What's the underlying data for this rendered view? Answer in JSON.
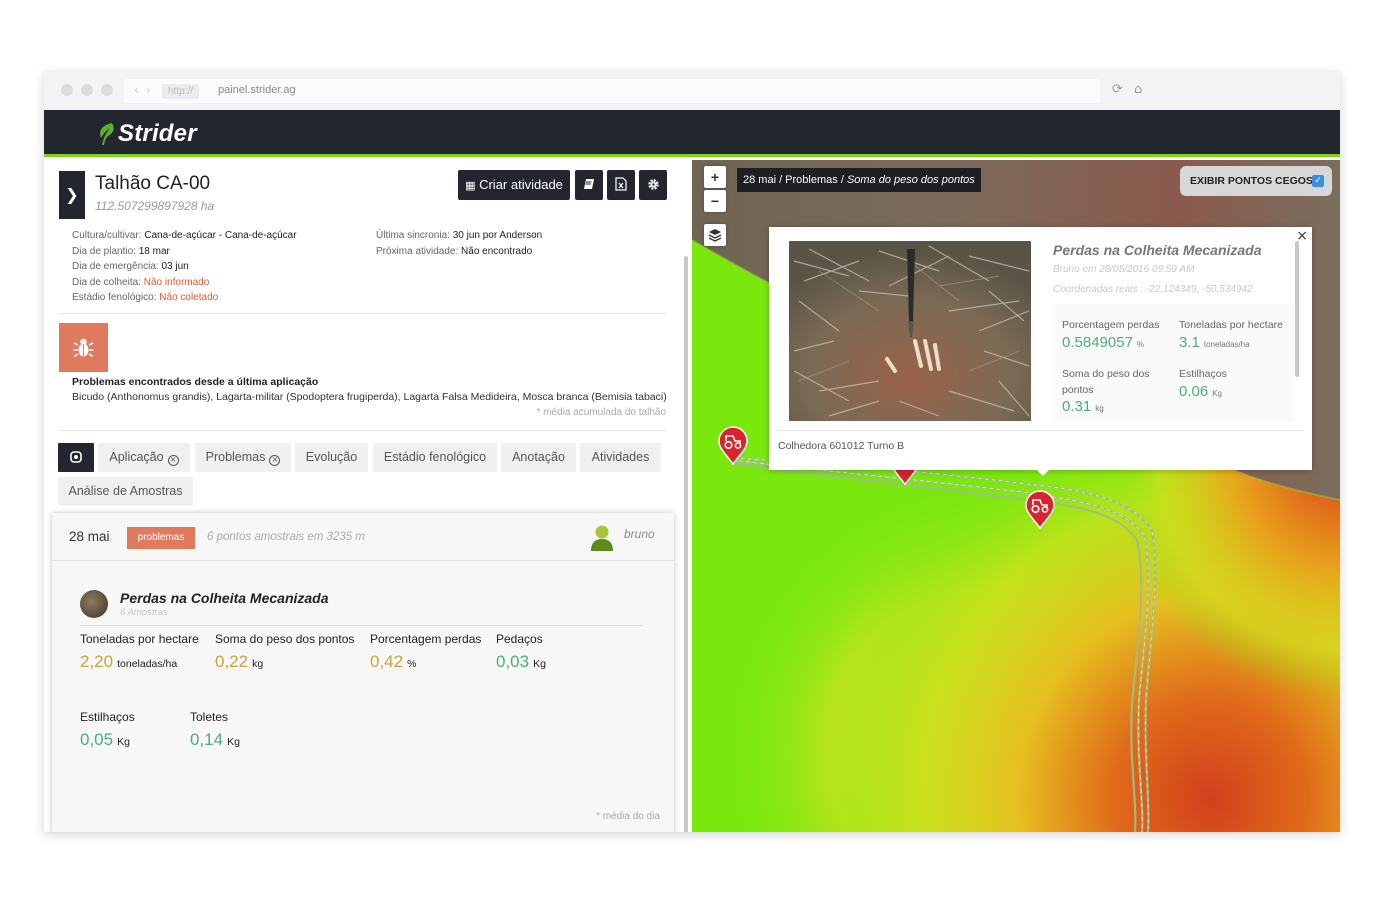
{
  "browser": {
    "url_proto": "http://",
    "url": "painel.strider.ag",
    "nav_back": "‹",
    "nav_forward": "›",
    "reload_glyph": "⟳",
    "home_glyph": "⌂"
  },
  "app": {
    "brand": "Strider",
    "accent": "#7ed321",
    "dark": "#23252f"
  },
  "field": {
    "title": "Talhão CA-00",
    "area": "112.507299897928 ha",
    "create_activity": "Criar atividade",
    "info_left": [
      {
        "label": "Cultura/cultivar: ",
        "value": "Cana-de-açúcar - Cana-de-açúcar",
        "status": "normal"
      },
      {
        "label": "Dia de plantio: ",
        "value": "18 mar",
        "status": "normal"
      },
      {
        "label": "Dia de emergência: ",
        "value": "03 jun",
        "status": "normal"
      },
      {
        "label": "Dia de colheita: ",
        "value": "Não informado",
        "status": "alert"
      },
      {
        "label": "Estádio fenológico: ",
        "value": "Não coletado",
        "status": "alert"
      }
    ],
    "info_right": [
      {
        "label": "Última sincronia: ",
        "value": "30 jun por Anderson"
      },
      {
        "label": "Próxima atividade: ",
        "value": "Não encontrado"
      }
    ]
  },
  "problems": {
    "title": "Problemas encontrados desde a última aplicação",
    "text": "Bicudo (Anthonomus grandis), Lagarta-militar (Spodoptera frugiperda), Lagarta Falsa Medideira, Mosca branca (Bemisia tabaci)",
    "note": "* média acumulada do talhão"
  },
  "tabs": {
    "aplicacao": "Aplicação",
    "problemas": "Problemas",
    "evolucao": "Evolução",
    "estadio": "Estádio fenológico",
    "anotacao": "Anotação",
    "atividades": "Atividades",
    "analise": "Análise de Amostras",
    "remove_glyph": "×"
  },
  "card": {
    "date": "28 mai",
    "badge": "problemas",
    "points": "6 pontos amostrais em 3235 m",
    "user": "bruno",
    "sample_title": "Perdas na Colheita Mecanizada",
    "sample_sub": "6 Amostras",
    "metrics": [
      {
        "label": "Toneladas por hectare",
        "value": "2,20",
        "unit": "toneladas/ha",
        "color": "#c9a23a"
      },
      {
        "label": "Soma do peso dos pontos",
        "value": "0,22",
        "unit": "kg",
        "color": "#c9a23a"
      },
      {
        "label": "Porcentagem perdas",
        "value": "0,42",
        "unit": "%",
        "color": "#c9a23a"
      },
      {
        "label": "Pedaços",
        "value": "0,03",
        "unit": "Kg",
        "color": "#4caf7a"
      },
      {
        "label": "Estilhaços",
        "value": "0,05",
        "unit": "Kg",
        "color": "#4caf7a"
      },
      {
        "label": "Toletes",
        "value": "0,14",
        "unit": "Kg",
        "color": "#4caf7a"
      }
    ],
    "note": "* média do dia"
  },
  "map": {
    "zoom_in": "+",
    "zoom_out": "−",
    "crumb_plain": "28 mai / Problemas / ",
    "crumb_italic": "Soma do peso dos pontos",
    "blind_points": "EXIBIR PONTOS CEGOS",
    "blind_checked": "✓",
    "popup": {
      "close": "×",
      "title": "Perdas na Colheita Mecanizada",
      "author_name": "Bruno",
      "author_date": " em 28/05/2016 09:59 AM",
      "coords": "Coordenadas reais : -22,124349, -50,534942",
      "metrics": [
        {
          "label": "Porcentagem perdas",
          "value": "0.5849057",
          "unit": "%"
        },
        {
          "label": "Toneladas por hectare",
          "value": "3.1",
          "unit": "toneladas/ha"
        },
        {
          "label": "Soma do peso dos pontos",
          "value": "0.31",
          "unit": "kg"
        },
        {
          "label": "Estilhaços",
          "value": "0.06",
          "unit": "Kg"
        }
      ],
      "footer": "Colhedora 601012 Turno B"
    }
  }
}
